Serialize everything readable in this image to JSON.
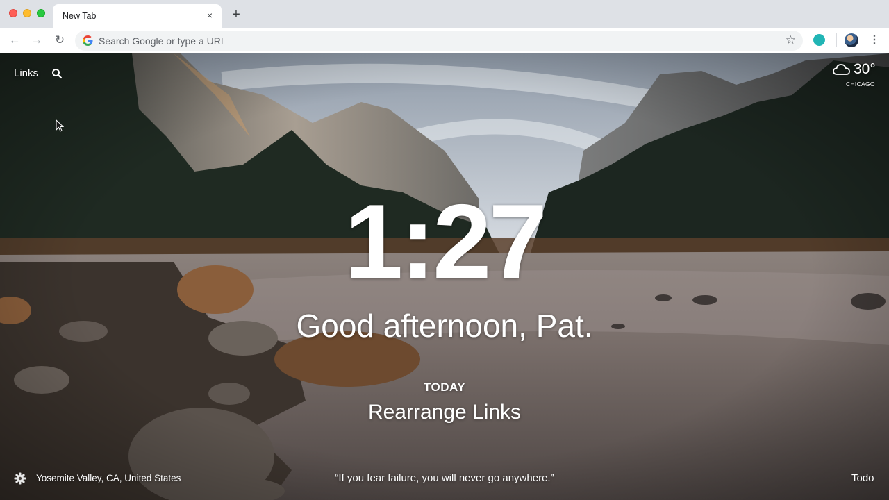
{
  "browser": {
    "tab_title": "New Tab",
    "tab_close": "×",
    "new_tab": "+",
    "omnibox_placeholder": "Search Google or type a URL",
    "back": "←",
    "forward": "→",
    "reload": "↻",
    "star": "☆",
    "menu": "⋮"
  },
  "momentum": {
    "links_label": "Links",
    "weather": {
      "temperature": "30°",
      "city": "CHICAGO",
      "icon": "cloud-icon"
    },
    "clock": "1:27",
    "greeting": "Good afternoon, Pat.",
    "focus": {
      "label": "TODAY",
      "task": "Rearrange Links"
    },
    "footer": {
      "location": "Yosemite Valley, CA, United States",
      "quote": "“If you fear failure, you will never go anywhere.”",
      "todo": "Todo"
    }
  },
  "colors": {
    "tabstrip": "#dee1e6",
    "extension": "#21b5b5",
    "sky": "#b9c6d4",
    "water": "#6e6460"
  }
}
